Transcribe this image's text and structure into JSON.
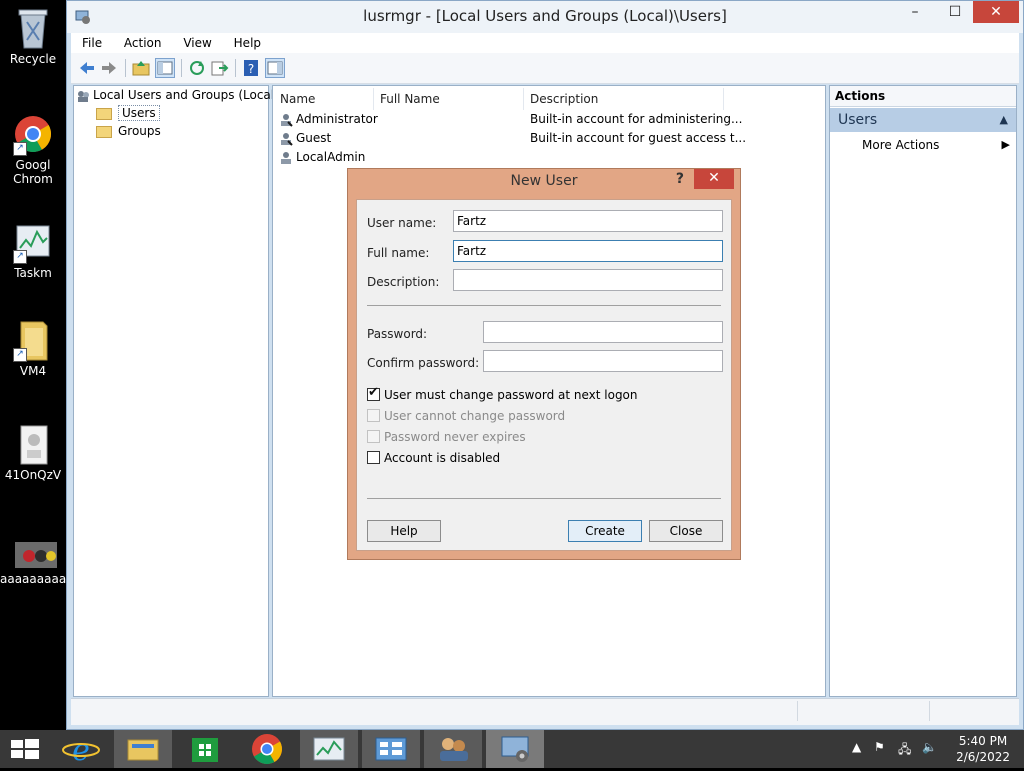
{
  "desktop": {
    "icons": [
      {
        "label": "Recycle",
        "icon": "recycle-bin-icon"
      },
      {
        "label": "Googl Chrom",
        "icon": "chrome-icon"
      },
      {
        "label": "Taskm",
        "icon": "task-manager-icon"
      },
      {
        "label": "VM4",
        "icon": "folder-icon"
      },
      {
        "label": "41OnQzV",
        "icon": "program-icon"
      },
      {
        "label": "aaaaaaaaaa",
        "icon": "game-icon"
      }
    ]
  },
  "window": {
    "title": "lusrmgr - [Local Users and Groups (Local)\\Users]",
    "controls": {
      "minimize": "–",
      "maximize": "☐",
      "close": "✕"
    },
    "menu": [
      "File",
      "Action",
      "View",
      "Help"
    ],
    "tree": {
      "root": "Local Users and Groups (Local)",
      "children": [
        "Users",
        "Groups"
      ]
    },
    "list": {
      "columns": [
        "Name",
        "Full Name",
        "Description"
      ],
      "rows": [
        {
          "name": "Administrator",
          "full_name": "",
          "description": "Built-in account for administering..."
        },
        {
          "name": "Guest",
          "full_name": "",
          "description": "Built-in account for guest access t..."
        },
        {
          "name": "LocalAdmin",
          "full_name": "",
          "description": ""
        }
      ]
    },
    "actions": {
      "title": "Actions",
      "group": "Users",
      "items": [
        "More Actions"
      ]
    }
  },
  "dialog": {
    "title": "New User",
    "help_glyph": "?",
    "close_glyph": "✕",
    "fields": {
      "user_name_label": "User name:",
      "user_name_value": "Fartz",
      "full_name_label": "Full name:",
      "full_name_value": "Fartz",
      "description_label": "Description:",
      "description_value": "",
      "password_label": "Password:",
      "confirm_label": "Confirm password:"
    },
    "checkboxes": [
      {
        "label": "User must change password at next logon",
        "checked": true,
        "enabled": true
      },
      {
        "label": "User cannot change password",
        "checked": false,
        "enabled": false
      },
      {
        "label": "Password never expires",
        "checked": false,
        "enabled": false
      },
      {
        "label": "Account is disabled",
        "checked": false,
        "enabled": true
      }
    ],
    "buttons": {
      "help": "Help",
      "create": "Create",
      "close": "Close"
    }
  },
  "taskbar": {
    "time": "5:40 PM",
    "date": "2/6/2022"
  },
  "colors": {
    "dialog_frame": "#e2a685",
    "close_red": "#c7463b",
    "actions_group": "#b7cde5"
  }
}
